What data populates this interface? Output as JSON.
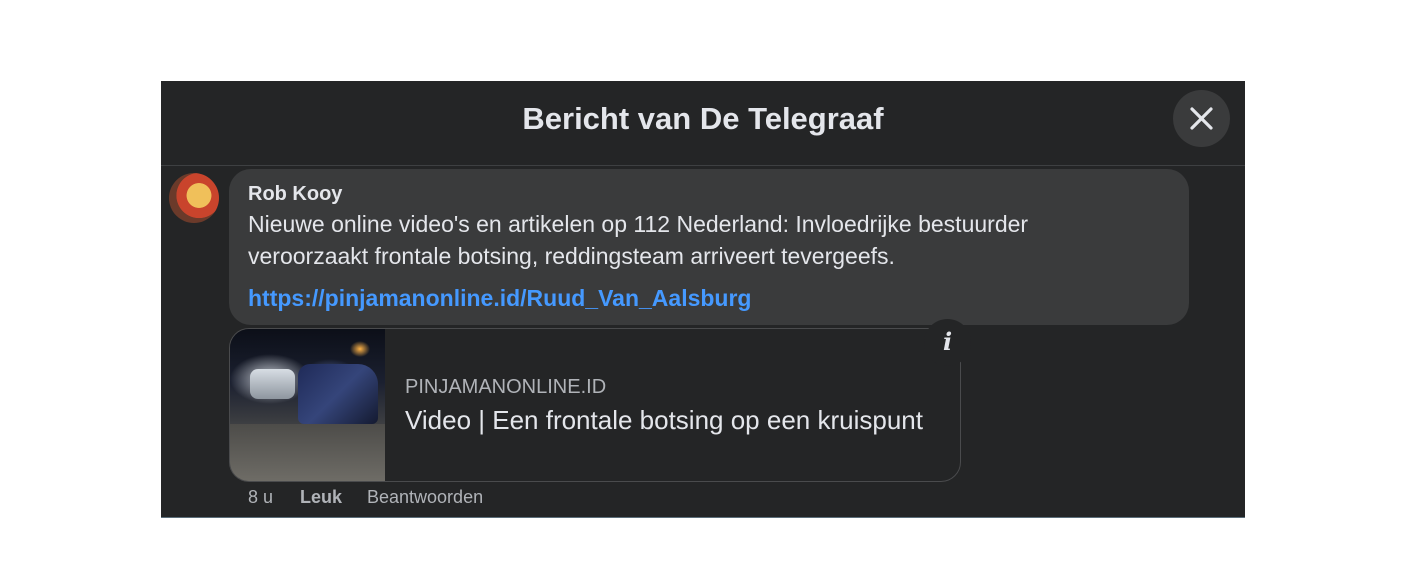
{
  "dialog": {
    "title": "Bericht van De Telegraaf",
    "close_icon": "close-icon"
  },
  "comment": {
    "author": "Rob Kooy",
    "text": "Nieuwe online video's en artikelen op 112 Nederland: Invloedrijke bestuurder veroorzaakt frontale botsing, reddingsteam arriveert tevergeefs.",
    "link": "https://pinjamanonline.id/Ruud_Van_Aalsburg"
  },
  "link_preview": {
    "domain": "PINJAMANONLINE.ID",
    "title": "Video | Een frontale botsing op een kruispunt",
    "info_label": "i"
  },
  "actions": {
    "time": "8 u",
    "like": "Leuk",
    "reply": "Beantwoorden"
  },
  "colors": {
    "background": "#242526",
    "bubble": "#3a3b3c",
    "link": "#4599ff",
    "text": "#e4e6eb",
    "secondary_text": "#b0b3b8"
  }
}
